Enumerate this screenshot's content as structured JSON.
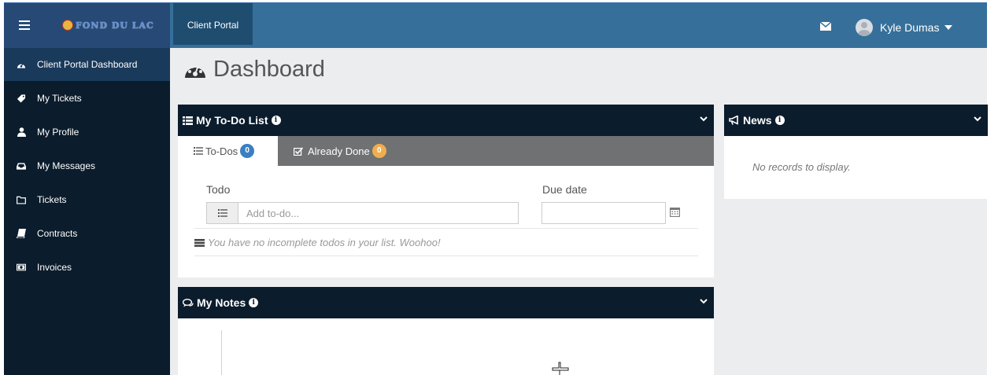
{
  "brand": {
    "logo_text": "FOND DU LAC"
  },
  "header": {
    "tab_label": "Client Portal",
    "user_name": "Kyle Dumas"
  },
  "sidebar": {
    "items": [
      {
        "label": "Client Portal Dashboard",
        "icon": "dashboard-icon",
        "active": true
      },
      {
        "label": "My Tickets",
        "icon": "ticket-icon"
      },
      {
        "label": "My Profile",
        "icon": "user-icon"
      },
      {
        "label": "My Messages",
        "icon": "inbox-icon"
      },
      {
        "label": "Tickets",
        "icon": "folder-icon"
      },
      {
        "label": "Contracts",
        "icon": "book-icon"
      },
      {
        "label": "Invoices",
        "icon": "money-icon"
      }
    ]
  },
  "page": {
    "title": "Dashboard"
  },
  "todo": {
    "title": "My To-Do List",
    "tabs": [
      {
        "label": "To-Dos",
        "count": "0",
        "badge_color": "#3a7fc1"
      },
      {
        "label": "Already Done",
        "count": "0",
        "badge_color": "#f0ad4e"
      }
    ],
    "todo_label": "Todo",
    "due_label": "Due date",
    "todo_placeholder": "Add to-do...",
    "empty_message": "You have no incomplete todos in your list. Woohoo!"
  },
  "news": {
    "title": "News",
    "empty_message": "No records to display."
  },
  "notes": {
    "title": "My Notes"
  },
  "colors": {
    "topbar": "#36709a",
    "sidebar": "#0b1c2c",
    "panel_header": "#0b1c2c"
  }
}
